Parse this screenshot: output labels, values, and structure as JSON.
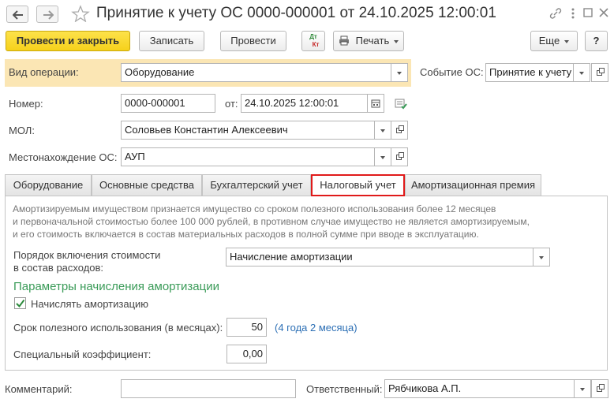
{
  "window": {
    "title": "Принятие к учету ОС 0000-000001 от 24.10.2025 12:00:01",
    "nav": {
      "back_icon": "arrow-left-icon",
      "forward_icon": "arrow-right-icon",
      "favorite_icon": "star-icon"
    },
    "controls": {
      "link_icon": "link-icon",
      "more_icon": "more-vertical-icon",
      "maximize_icon": "maximize-icon",
      "close_icon": "close-icon"
    }
  },
  "toolbar": {
    "post_and_close": "Провести и закрыть",
    "save": "Записать",
    "post": "Провести",
    "dtkt_top": "Дт",
    "dtkt_bottom": "Кт",
    "print": "Печать",
    "more": "Еще",
    "help": "?"
  },
  "form": {
    "operation_type": {
      "label": "Вид операции:",
      "value": "Оборудование"
    },
    "event": {
      "label": "Событие ОС:",
      "value": "Принятие к учету"
    },
    "number": {
      "label": "Номер:",
      "value": "0000-000001"
    },
    "date": {
      "label": "от:",
      "value": "24.10.2025 12:00:01"
    },
    "mol": {
      "label": "МОЛ:",
      "value": "Соловьев Константин Алексеевич"
    },
    "location": {
      "label": "Местонахождение ОС:",
      "value": "АУП"
    },
    "comment": {
      "label": "Комментарий:",
      "value": ""
    },
    "responsible": {
      "label": "Ответственный:",
      "value": "Рябчикова А.П."
    }
  },
  "tabs": [
    {
      "label": "Оборудование",
      "active": false
    },
    {
      "label": "Основные средства",
      "active": false
    },
    {
      "label": "Бухгалтерский учет",
      "active": false
    },
    {
      "label": "Налоговый учет",
      "active": true
    },
    {
      "label": "Амортизационная премия",
      "active": false
    }
  ],
  "tax_tab": {
    "info_lines": [
      "Амортизируемым имуществом признается имущество со сроком полезного использования более 12 месяцев",
      "и первоначальной стоимостью более 100 000 рублей, в противном случае имущество не является амортизируемым,",
      "и его стоимость включается в состав материальных расходов в полной сумме при вводе в эксплуатацию."
    ],
    "cost_order": {
      "label_line1": "Порядок включения стоимости",
      "label_line2": "в состав расходов:",
      "value": "Начисление амортизации"
    },
    "section_title": "Параметры начисления амортизации",
    "accrue_checkbox": {
      "label": "Начислять амортизацию",
      "checked": true
    },
    "useful_life": {
      "label": "Срок полезного использования (в месяцах):",
      "value": "50",
      "hint": "(4 года 2 месяца)"
    },
    "special_coef": {
      "label": "Специальный коэффициент:",
      "value": "0,00"
    }
  },
  "colors": {
    "accent_yellow": "#f6d11b",
    "highlight_row": "#fbe6b4",
    "section_green": "#3a9b58",
    "link_blue": "#2c6fb5",
    "active_tab_border": "#e01a1a"
  }
}
